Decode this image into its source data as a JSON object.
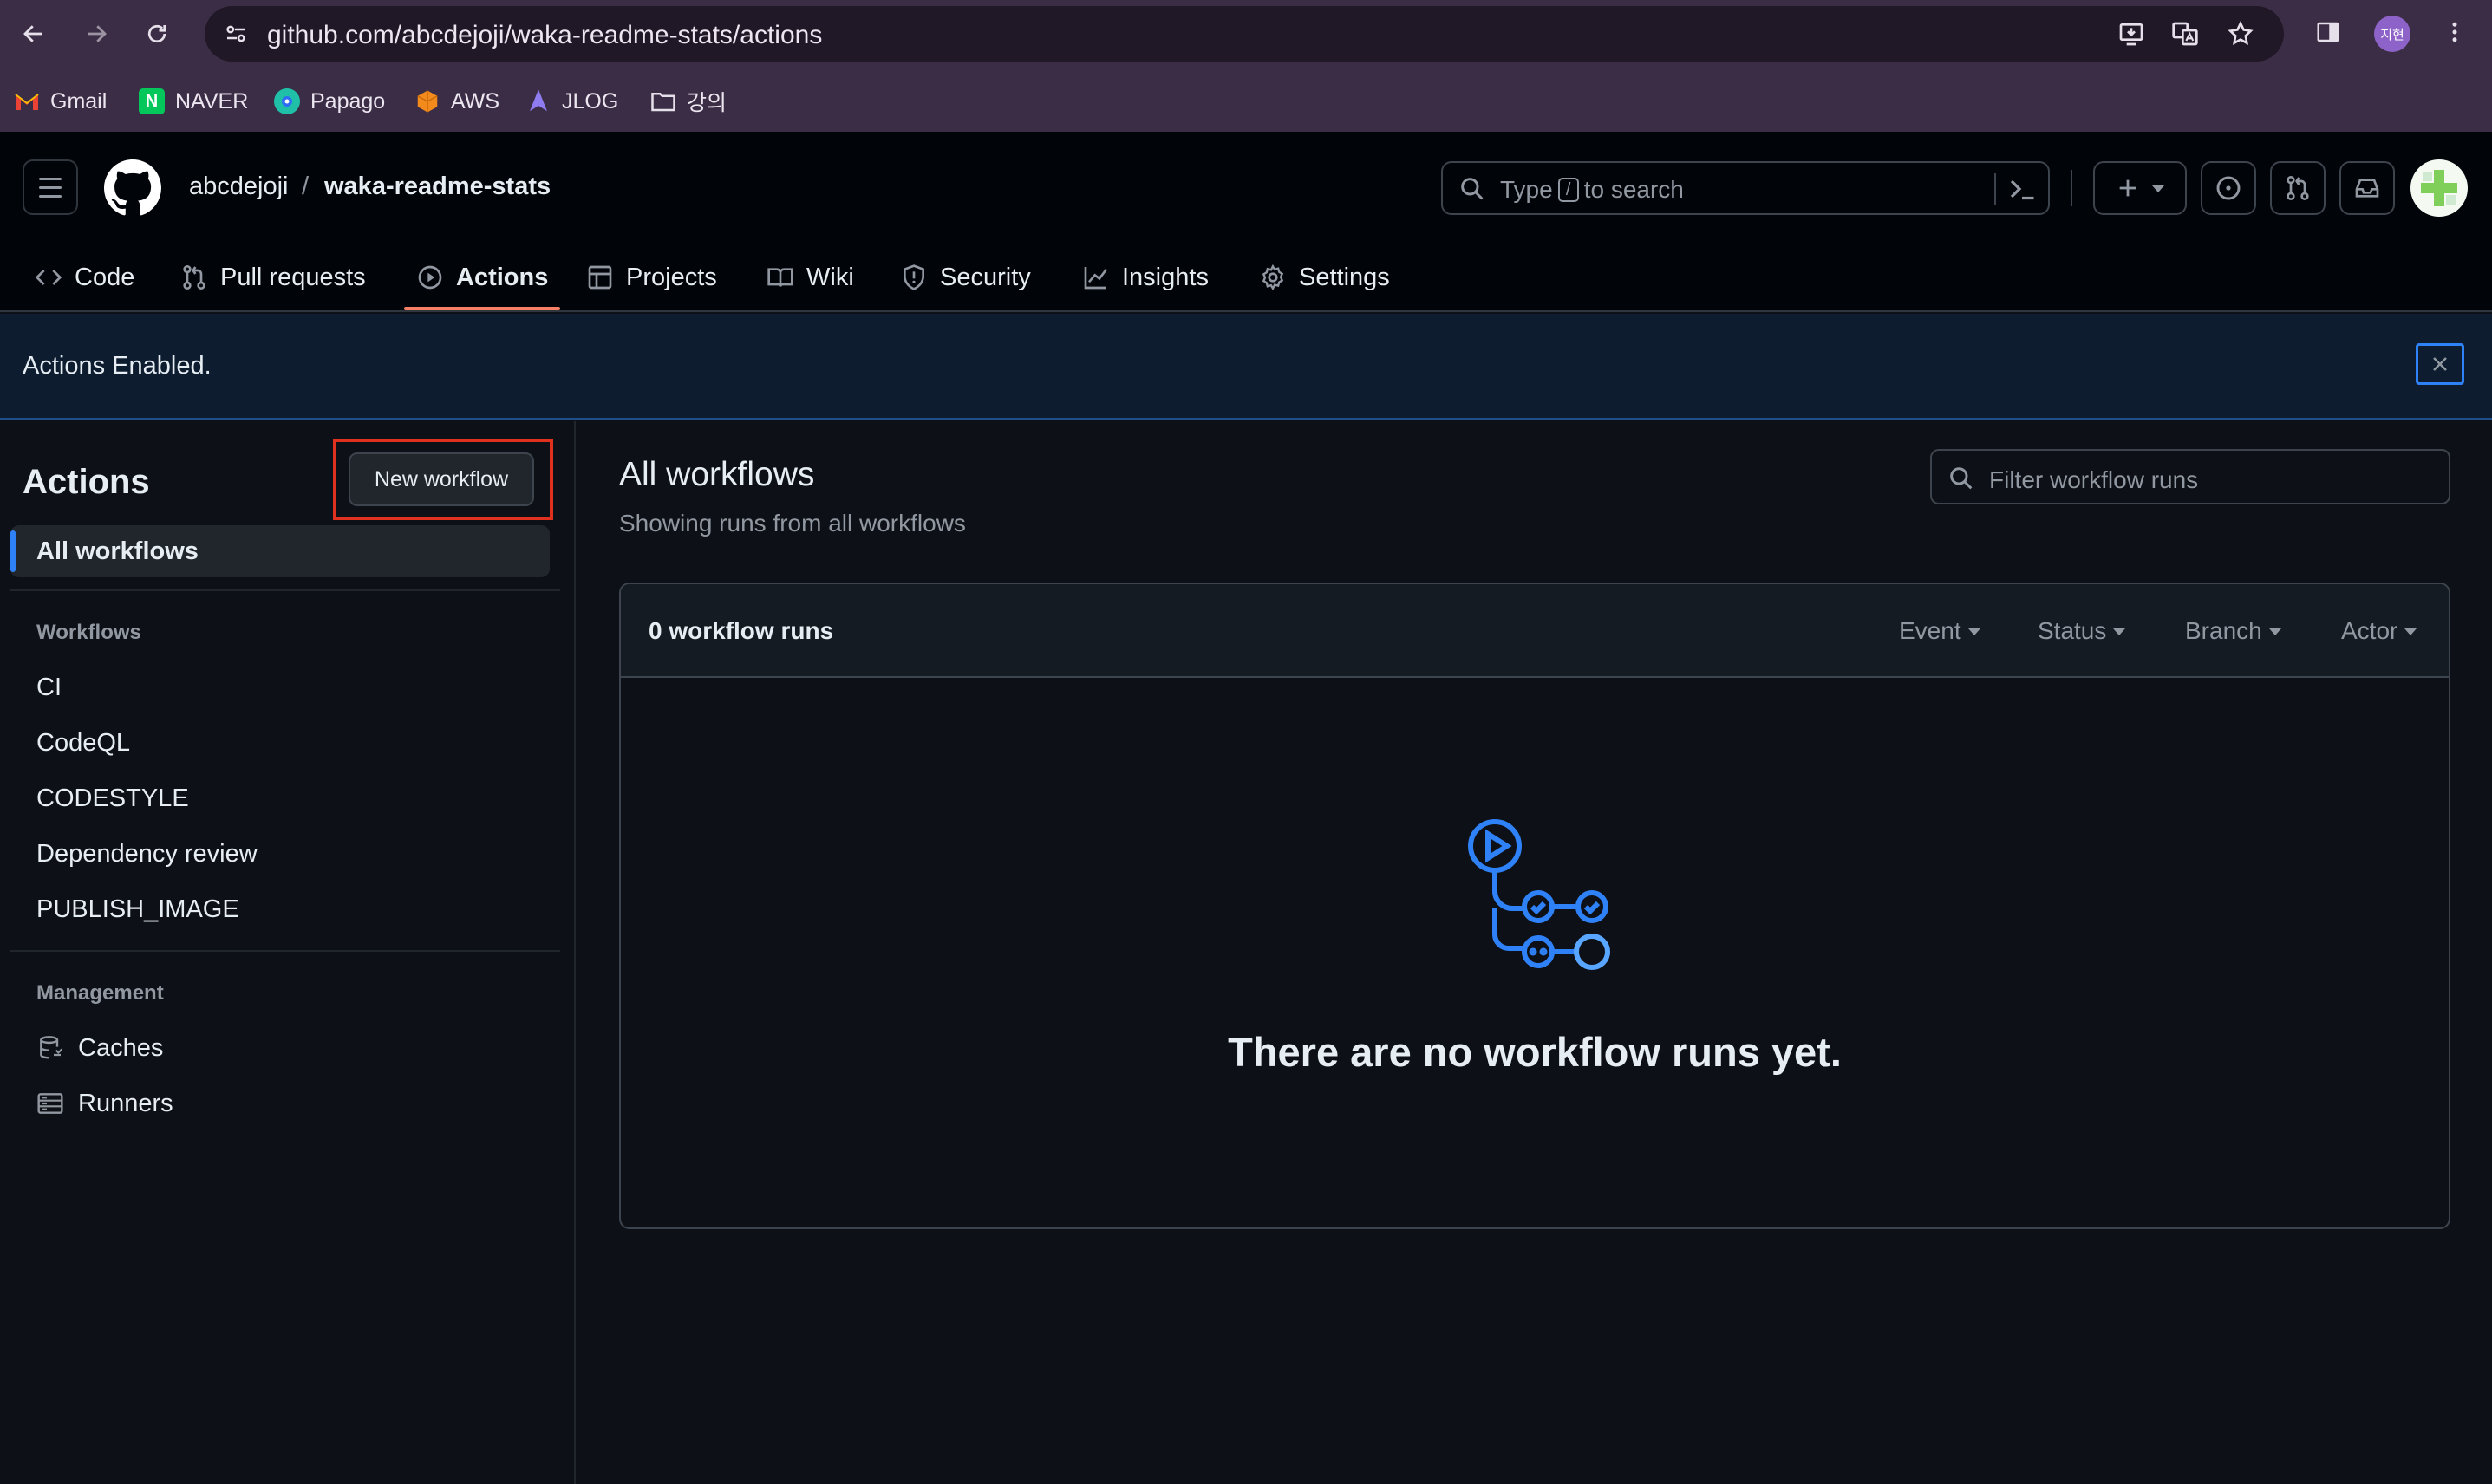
{
  "browser": {
    "url": "github.com/abcdejoji/waka-readme-stats/actions",
    "profile_initials": "지현",
    "bookmarks": [
      {
        "label": "Gmail",
        "icon": "gmail-icon"
      },
      {
        "label": "NAVER",
        "icon": "naver-icon"
      },
      {
        "label": "Papago",
        "icon": "papago-icon"
      },
      {
        "label": "AWS",
        "icon": "aws-icon"
      },
      {
        "label": "JLOG",
        "icon": "jlog-icon"
      },
      {
        "label": "강의",
        "icon": "folder-icon"
      }
    ]
  },
  "header": {
    "owner": "abcdejoji",
    "separator": "/",
    "repo": "waka-readme-stats",
    "search_prefix": "Type",
    "search_key": "/",
    "search_suffix": "to search",
    "tabs": [
      {
        "label": "Code",
        "icon": "code-icon"
      },
      {
        "label": "Pull requests",
        "icon": "pull-request-icon"
      },
      {
        "label": "Actions",
        "icon": "play-icon",
        "active": true
      },
      {
        "label": "Projects",
        "icon": "table-icon"
      },
      {
        "label": "Wiki",
        "icon": "book-icon"
      },
      {
        "label": "Security",
        "icon": "shield-icon"
      },
      {
        "label": "Insights",
        "icon": "graph-icon"
      },
      {
        "label": "Settings",
        "icon": "gear-icon"
      }
    ]
  },
  "flash": {
    "message": "Actions Enabled."
  },
  "sidebar": {
    "title": "Actions",
    "new_workflow_label": "New workflow",
    "selected": "All workflows",
    "workflows_heading": "Workflows",
    "workflows": [
      "CI",
      "CodeQL",
      "CODESTYLE",
      "Dependency review",
      "PUBLISH_IMAGE"
    ],
    "management_heading": "Management",
    "management": [
      {
        "label": "Caches",
        "icon": "database-icon"
      },
      {
        "label": "Runners",
        "icon": "server-icon"
      }
    ]
  },
  "main": {
    "title": "All workflows",
    "subtitle": "Showing runs from all workflows",
    "filter_placeholder": "Filter workflow runs",
    "runs_count": "0 workflow runs",
    "filters": [
      "Event",
      "Status",
      "Branch",
      "Actor"
    ],
    "empty_message": "There are no workflow runs yet."
  },
  "colors": {
    "accent_blue": "#2f81f7",
    "tab_underline": "#f78166",
    "highlight_red": "#e0311f"
  }
}
